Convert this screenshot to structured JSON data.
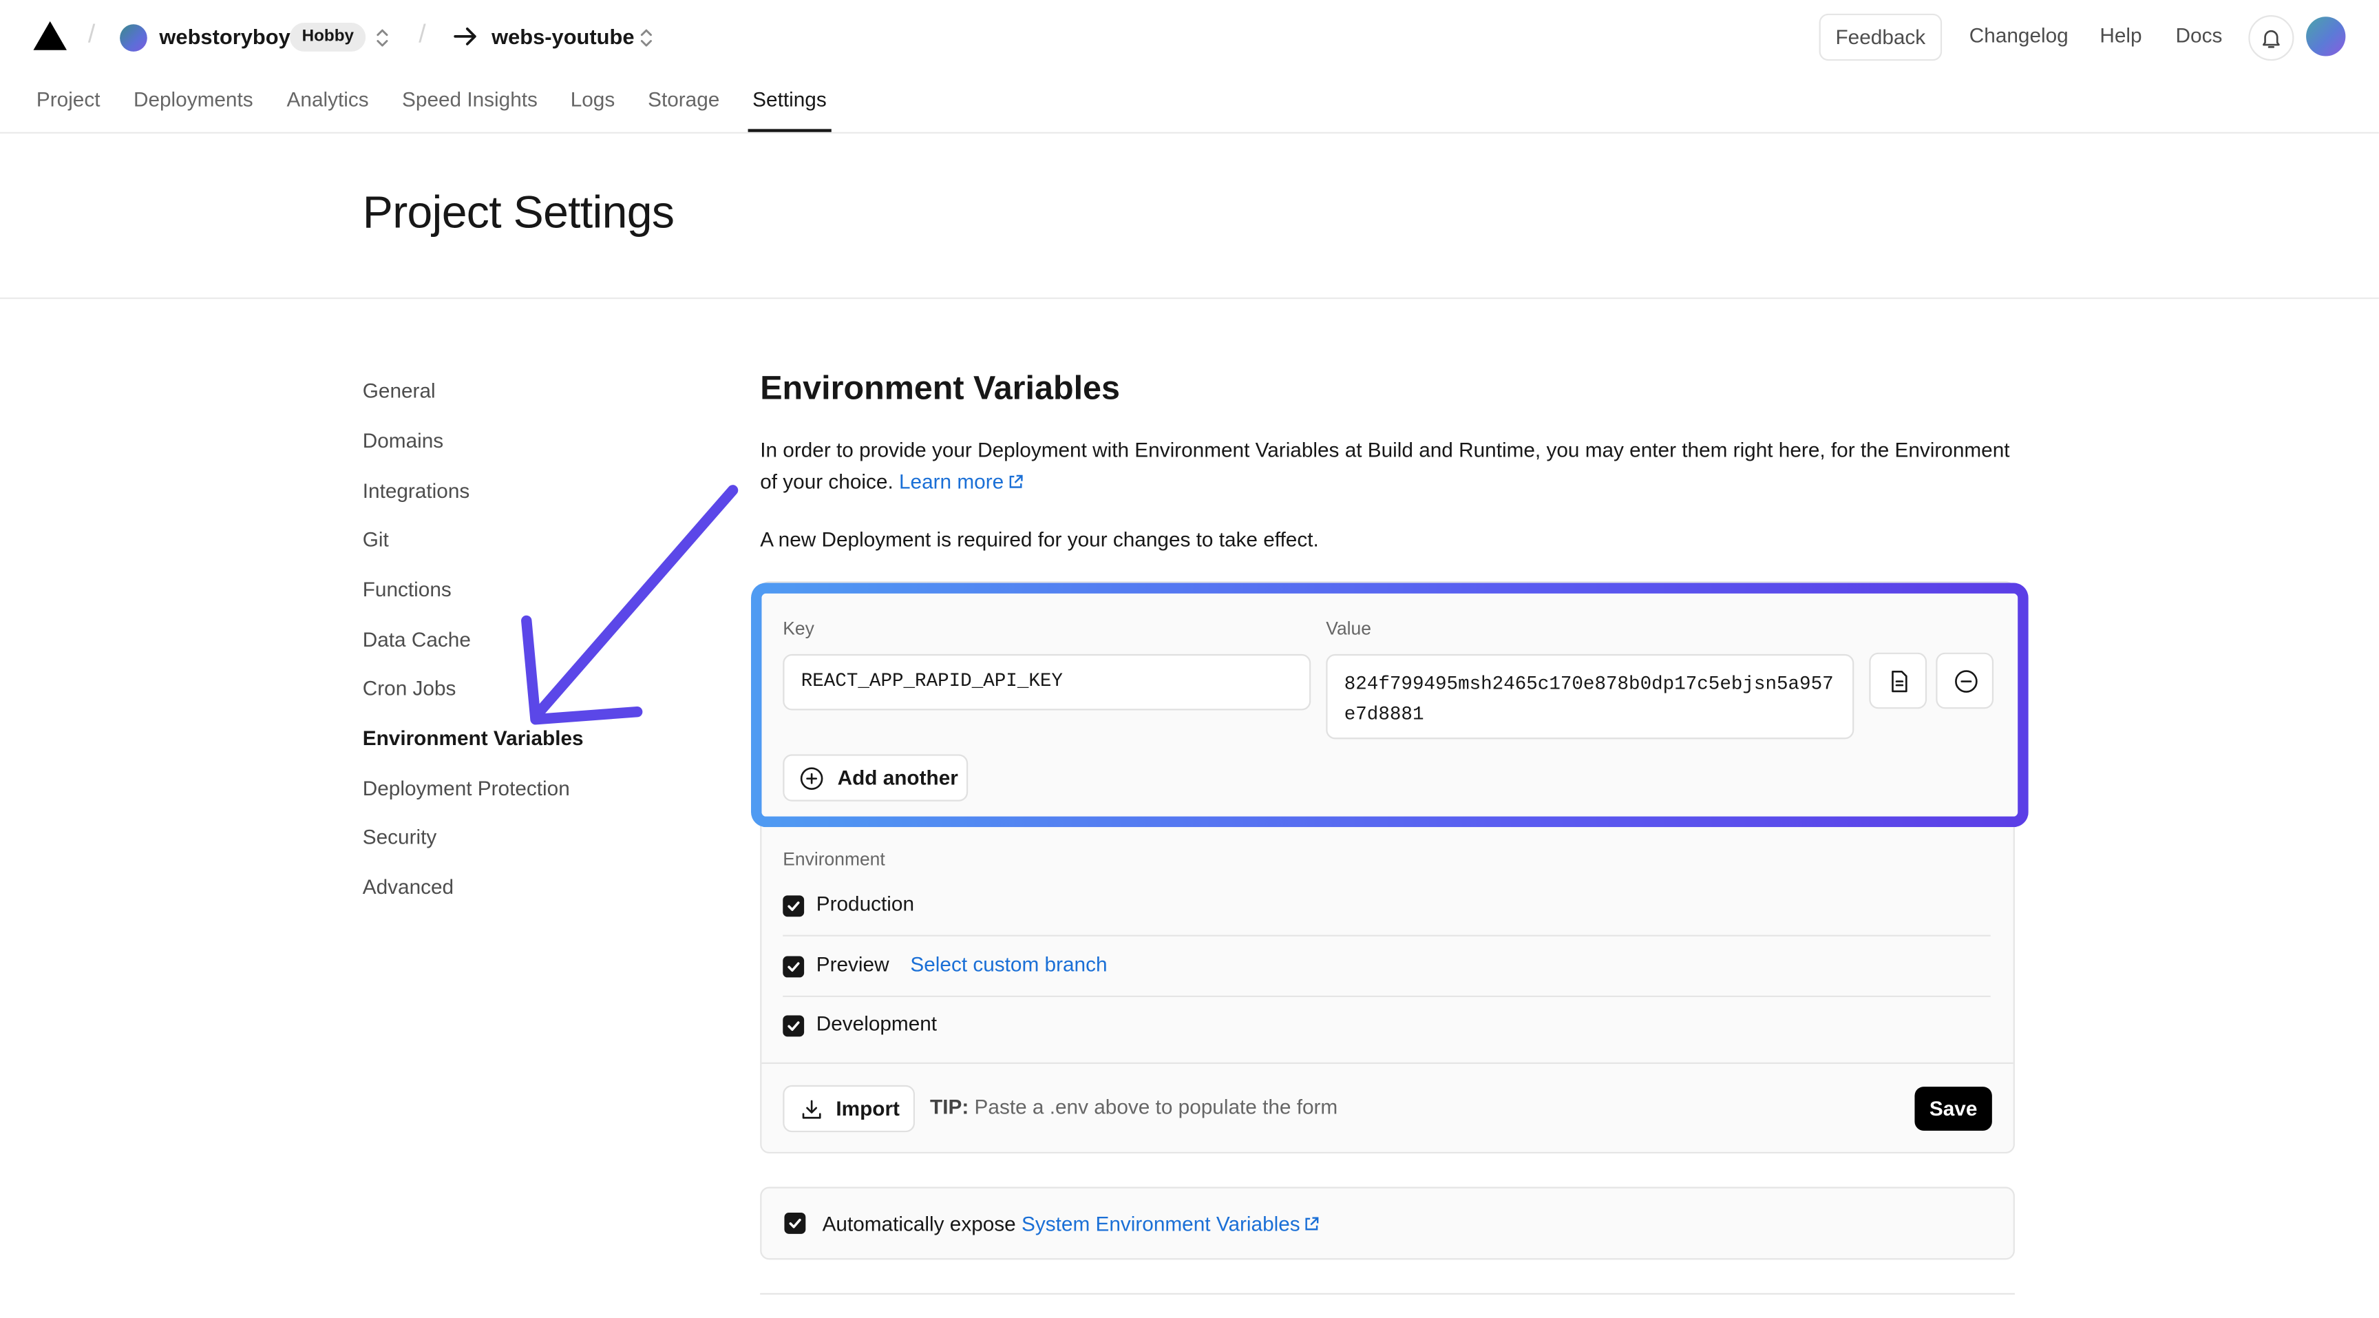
{
  "topbar": {
    "team_name": "webstoryboy",
    "plan_badge": "Hobby",
    "project_name": "webs-youtube",
    "links": {
      "feedback": "Feedback",
      "changelog": "Changelog",
      "help": "Help",
      "docs": "Docs"
    }
  },
  "nav": {
    "tabs": [
      "Project",
      "Deployments",
      "Analytics",
      "Speed Insights",
      "Logs",
      "Storage",
      "Settings"
    ],
    "active": "Settings"
  },
  "header": {
    "title": "Project Settings"
  },
  "sidebar": {
    "items": [
      "General",
      "Domains",
      "Integrations",
      "Git",
      "Functions",
      "Data Cache",
      "Cron Jobs",
      "Environment Variables",
      "Deployment Protection",
      "Security",
      "Advanced"
    ],
    "active": "Environment Variables"
  },
  "main": {
    "title": "Environment Variables",
    "description": "In order to provide your Deployment with Environment Variables at Build and Runtime, you may enter them right here, for the Environment of your choice.",
    "learn_more": "Learn more",
    "note": "A new Deployment is required for your changes to take effect.",
    "form": {
      "key_label": "Key",
      "value_label": "Value",
      "key_value": "REACT_APP_RAPID_API_KEY",
      "value_value": "824f799495msh2465c170e878b0dp17c5ebjsn5a957e7d8881",
      "add_another": "Add another",
      "environment_label": "Environment",
      "environments": [
        {
          "name": "Production",
          "checked": true
        },
        {
          "name": "Preview",
          "checked": true
        },
        {
          "name": "Development",
          "checked": true
        }
      ],
      "select_custom_branch": "Select custom branch",
      "import_label": "Import",
      "tip_label": "TIP:",
      "tip_text": "Paste a .env above to populate the form",
      "save_label": "Save"
    },
    "expose": {
      "text": "Automatically expose",
      "link": "System Environment Variables",
      "checked": true
    }
  },
  "colors": {
    "link": "#1a6fd6",
    "highlight_start": "#4f9bf2",
    "highlight_end": "#5b3ee6",
    "arrow": "#5b47e8"
  }
}
